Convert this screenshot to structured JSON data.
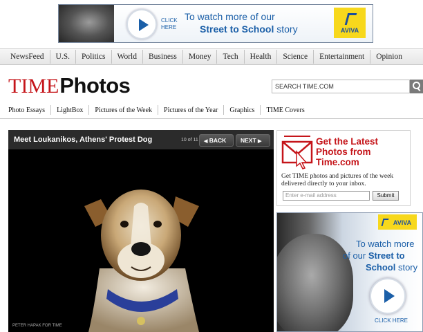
{
  "top_ad": {
    "click_label": "CLICK HERE",
    "line1": "To watch more of our",
    "line2_bold": "Street to School",
    "line2_rest": " story",
    "brand": "AVIVA"
  },
  "nav": {
    "items": [
      "NewsFeed",
      "U.S.",
      "Politics",
      "World",
      "Business",
      "Money",
      "Tech",
      "Health",
      "Science",
      "Entertainment",
      "Opinion"
    ]
  },
  "logo": {
    "time": "TIME",
    "photos": "Photos"
  },
  "search": {
    "placeholder": "SEARCH TIME.COM"
  },
  "subnav": {
    "items": [
      "Photo Essays",
      "LightBox",
      "Pictures of the Week",
      "Pictures of the Year",
      "Graphics",
      "TIME Covers"
    ]
  },
  "gallery": {
    "title": "Meet Loukanikos, Athens' Protest Dog",
    "count": "10 of 11",
    "back_label": "BACK",
    "next_label": "NEXT",
    "credit": "PETER HAPAK FOR TIME"
  },
  "newsletter": {
    "headline": "Get the Latest Photos from Time.com",
    "description": "Get TIME photos and pictures of the week delivered directly to your inbox.",
    "email_placeholder": "Enter e-mail address",
    "submit_label": "Submit"
  },
  "side_ad": {
    "brand": "AVIVA",
    "line1": "To watch more",
    "line2_pre": "of our ",
    "line2_bold": "Street to",
    "line3_bold": "School",
    "line3_rest": " story",
    "click_label": "CLICK HERE"
  },
  "colors": {
    "time_red": "#c5151a",
    "aviva_blue": "#1b5fa8",
    "aviva_yellow": "#f7d81c"
  }
}
